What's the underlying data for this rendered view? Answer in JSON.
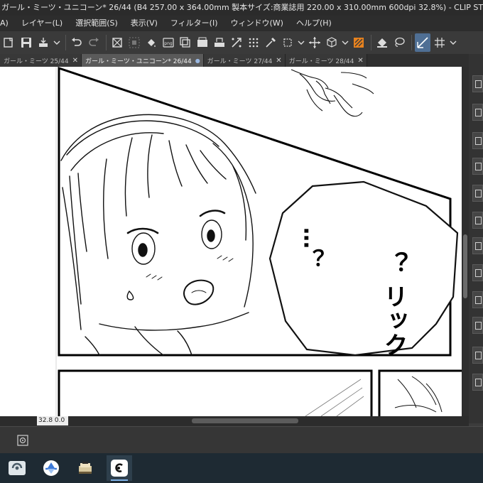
{
  "window": {
    "title": "ガール・ミーツ・ユニコーン* 26/44 (B4 257.00 x 364.00mm 製本サイズ:商業誌用 220.00 x 310.00mm 600dpi 32.8%) - CLIP STUDIO PAINT EX"
  },
  "menu": {
    "items": [
      "A)",
      "レイヤー(L)",
      "選択範囲(S)",
      "表示(V)",
      "フィルター(I)",
      "ウィンドウ(W)",
      "ヘルプ(H)"
    ]
  },
  "tabs": [
    {
      "label": "ガール・ミーツ 25/44"
    },
    {
      "label": "ガール・ミーツ・ユニコーン* 26/44"
    },
    {
      "label": "ガール・ミーツ 27/44"
    },
    {
      "label": "ガール・ミーツ 28/44"
    }
  ],
  "canvas": {
    "speech_bubble": {
      "column_right": "？ リック",
      "column_left": "…？"
    }
  },
  "status": {
    "zoom": "32.8 0.0"
  },
  "icons": {
    "toolbar": [
      "new-file-icon",
      "save-icon",
      "export-icon",
      "undo-icon",
      "redo-icon",
      "clear-icon",
      "clear-outside-icon",
      "fill-icon",
      "png-icon",
      "copy-icon",
      "cut-icon",
      "paste-icon",
      "transform-icon",
      "tone-icon",
      "eyedropper-icon",
      "crop-icon",
      "move-icon",
      "3d-icon",
      "layer-color-icon",
      "fill-bucket-icon",
      "lasso-icon",
      "ruler-icon",
      "snap-icon"
    ],
    "taskbar": [
      "clip-studio-icon",
      "paint-brush-app-icon",
      "archive-app-icon",
      "clip-studio-paint-icon"
    ]
  },
  "colors": {
    "accent": "#4f6f94",
    "taskbar": "#1e2a33",
    "tool-orange": "#e8821e"
  }
}
